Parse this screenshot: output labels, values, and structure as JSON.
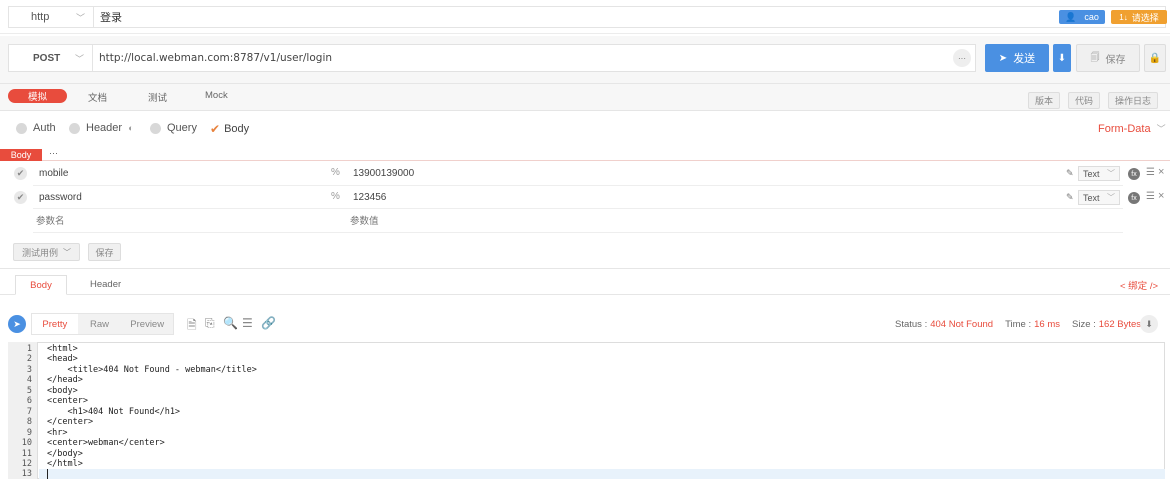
{
  "request": {
    "protocol": "http",
    "name": "登录",
    "method": "POST",
    "url": "http://local.webman.com:8787/v1/user/login",
    "url_more": "···"
  },
  "top_right": {
    "user": "cao",
    "select": "请选择",
    "select_prefix": "1↓"
  },
  "actions": {
    "send": "发送",
    "save": "保存"
  },
  "main_tabs": [
    "模拟",
    "文档",
    "测试",
    "Mock"
  ],
  "right_tabs": [
    "版本",
    "代码",
    "操作日志"
  ],
  "param_tabs": {
    "auth": "Auth",
    "header": "Header",
    "query": "Query",
    "body": "Body"
  },
  "form_data": "Form-Data",
  "body_label": "Body",
  "body_more": "···",
  "params": [
    {
      "key": "mobile",
      "value": "13900139000",
      "type": "Text"
    },
    {
      "key": "password",
      "value": "123456",
      "type": "Text"
    }
  ],
  "placeholders": {
    "key": "参数名",
    "value": "参数值"
  },
  "bottom_buttons": {
    "test_case": "测试用例",
    "save": "保存"
  },
  "response_tabs": [
    "Body",
    "Header"
  ],
  "bind_link": "< 绑定 />",
  "view_tabs": [
    "Pretty",
    "Raw",
    "Preview"
  ],
  "status": {
    "status_label": "Status :",
    "status_value": "404 Not Found",
    "time_label": "Time :",
    "time_value": "16 ms",
    "size_label": "Size :",
    "size_value": "162 Bytes"
  },
  "code_lines": [
    "<html>",
    "<head>",
    "    <title>404 Not Found - webman</title>",
    "</head>",
    "<body>",
    "<center>",
    "    <h1>404 Not Found</h1>",
    "</center>",
    "<hr>",
    "<center>webman</center>",
    "</body>",
    "</html>",
    ""
  ],
  "line_numbers": [
    "1",
    "2",
    "3",
    "4",
    "5",
    "6",
    "7",
    "8",
    "9",
    "10",
    "11",
    "12",
    "13"
  ],
  "colors": {
    "accent": "#e84c3d",
    "blue": "#4a90e2",
    "orange": "#f0a030"
  }
}
